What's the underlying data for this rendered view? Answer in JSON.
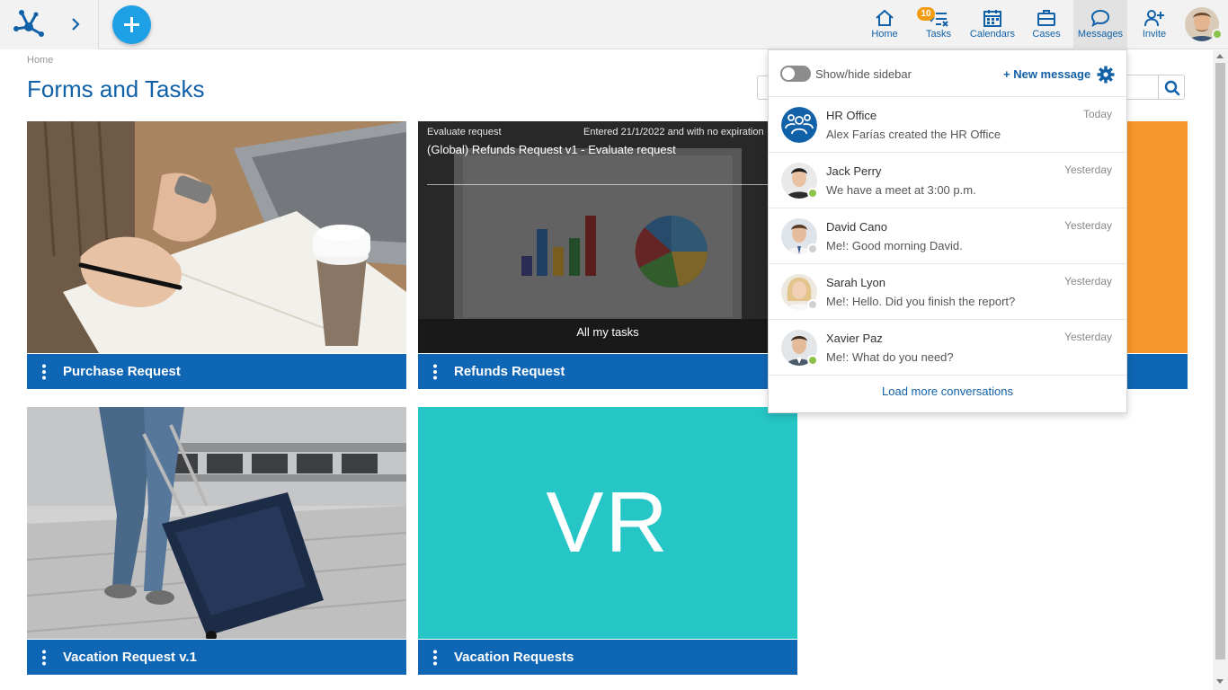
{
  "nav": {
    "home_label": "Home",
    "tasks_label": "Tasks",
    "tasks_badge": "10",
    "calendars_label": "Calendars",
    "cases_label": "Cases",
    "messages_label": "Messages",
    "invite_label": "Invite"
  },
  "main": {
    "breadcrumb": "Home",
    "title": "Forms and Tasks"
  },
  "cards": [
    {
      "title": "Purchase Request"
    },
    {
      "title": "Refunds Request",
      "overlay_label": "Evaluate request",
      "overlay_entered": "Entered 21/1/2022 and with no expiration",
      "overlay_task": "(Global) Refunds Request v1 - Evaluate request",
      "overlay_all": "All my tasks"
    },
    {
      "title": "Vacation Request v.1"
    },
    {
      "title": "Vacation Requests",
      "initials": "VR",
      "color": "#26c6c6"
    }
  ],
  "messages_popup": {
    "toggle_label": "Show/hide sidebar",
    "new_message": "+ New message",
    "load_more": "Load more conversations",
    "conversations": [
      {
        "name": "HR Office",
        "when": "Today",
        "preview": "Alex Farías created the HR Office"
      },
      {
        "name": "Jack Perry",
        "when": "Yesterday",
        "preview": "We have a meet at 3:00 p.m.",
        "status": "online"
      },
      {
        "name": "David Cano",
        "when": "Yesterday",
        "preview": "Me!: Good morning David.",
        "status": "offline"
      },
      {
        "name": "Sarah Lyon",
        "when": "Yesterday",
        "preview": "Me!: Hello. Did you finish the report?",
        "status": "offline"
      },
      {
        "name": "Xavier Paz",
        "when": "Yesterday",
        "preview": "Me!: What do you need?",
        "status": "online"
      }
    ]
  },
  "colors": {
    "brand_blue": "#1161a8",
    "card_footer": "#0f66b4",
    "new_button": "#1ea0e6",
    "orange_card": "#f7962a",
    "online": "#8bc34a",
    "offline": "#cfcfcf"
  },
  "icons": [
    "app-logo-icon",
    "chevron-right-icon",
    "plus-icon",
    "home-icon",
    "tasks-icon",
    "calendar-icon",
    "briefcase-icon",
    "chat-bubble-icon",
    "add-user-icon",
    "search-icon",
    "gear-icon",
    "kebab-menu-icon"
  ]
}
